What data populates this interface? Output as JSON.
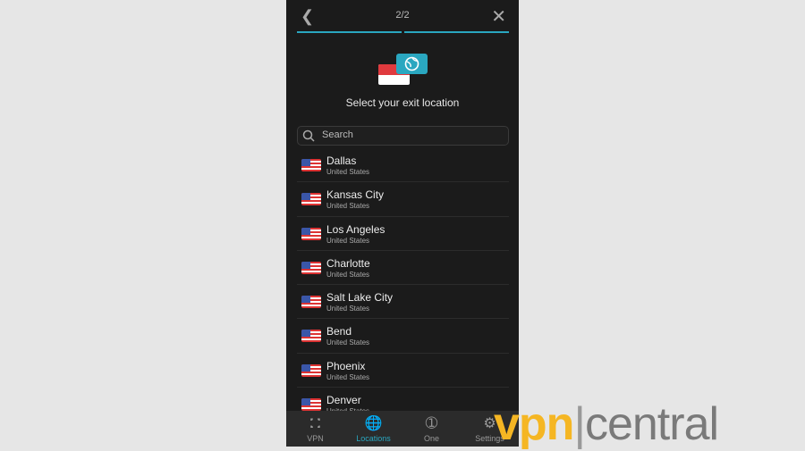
{
  "header": {
    "step": "2/2",
    "back_icon": "chevron-left-icon",
    "close_icon": "close-icon",
    "progress_steps_done": 2,
    "progress_steps_total": 2
  },
  "hero": {
    "icon": "singapore-flag-with-globe-icon",
    "title": "Select your exit location"
  },
  "search": {
    "placeholder": "Search",
    "value": ""
  },
  "locations": [
    {
      "city": "Dallas",
      "country": "United States"
    },
    {
      "city": "Kansas City",
      "country": "United States"
    },
    {
      "city": "Los Angeles",
      "country": "United States"
    },
    {
      "city": "Charlotte",
      "country": "United States"
    },
    {
      "city": "Salt Lake City",
      "country": "United States"
    },
    {
      "city": "Bend",
      "country": "United States"
    },
    {
      "city": "Phoenix",
      "country": "United States"
    },
    {
      "city": "Denver",
      "country": "United States"
    }
  ],
  "nav": [
    {
      "label": "VPN",
      "icon": "shield-icon"
    },
    {
      "label": "Locations",
      "icon": "globe-icon",
      "active": true
    },
    {
      "label": "One",
      "icon": "one-shield-icon"
    },
    {
      "label": "Settings",
      "icon": "gear-icon"
    }
  ],
  "watermark": {
    "part1": "vpn",
    "part2": "central"
  },
  "colors": {
    "accent": "#2aa7c0",
    "background": "#1b1b1b",
    "logo_orange": "#f5b623"
  }
}
